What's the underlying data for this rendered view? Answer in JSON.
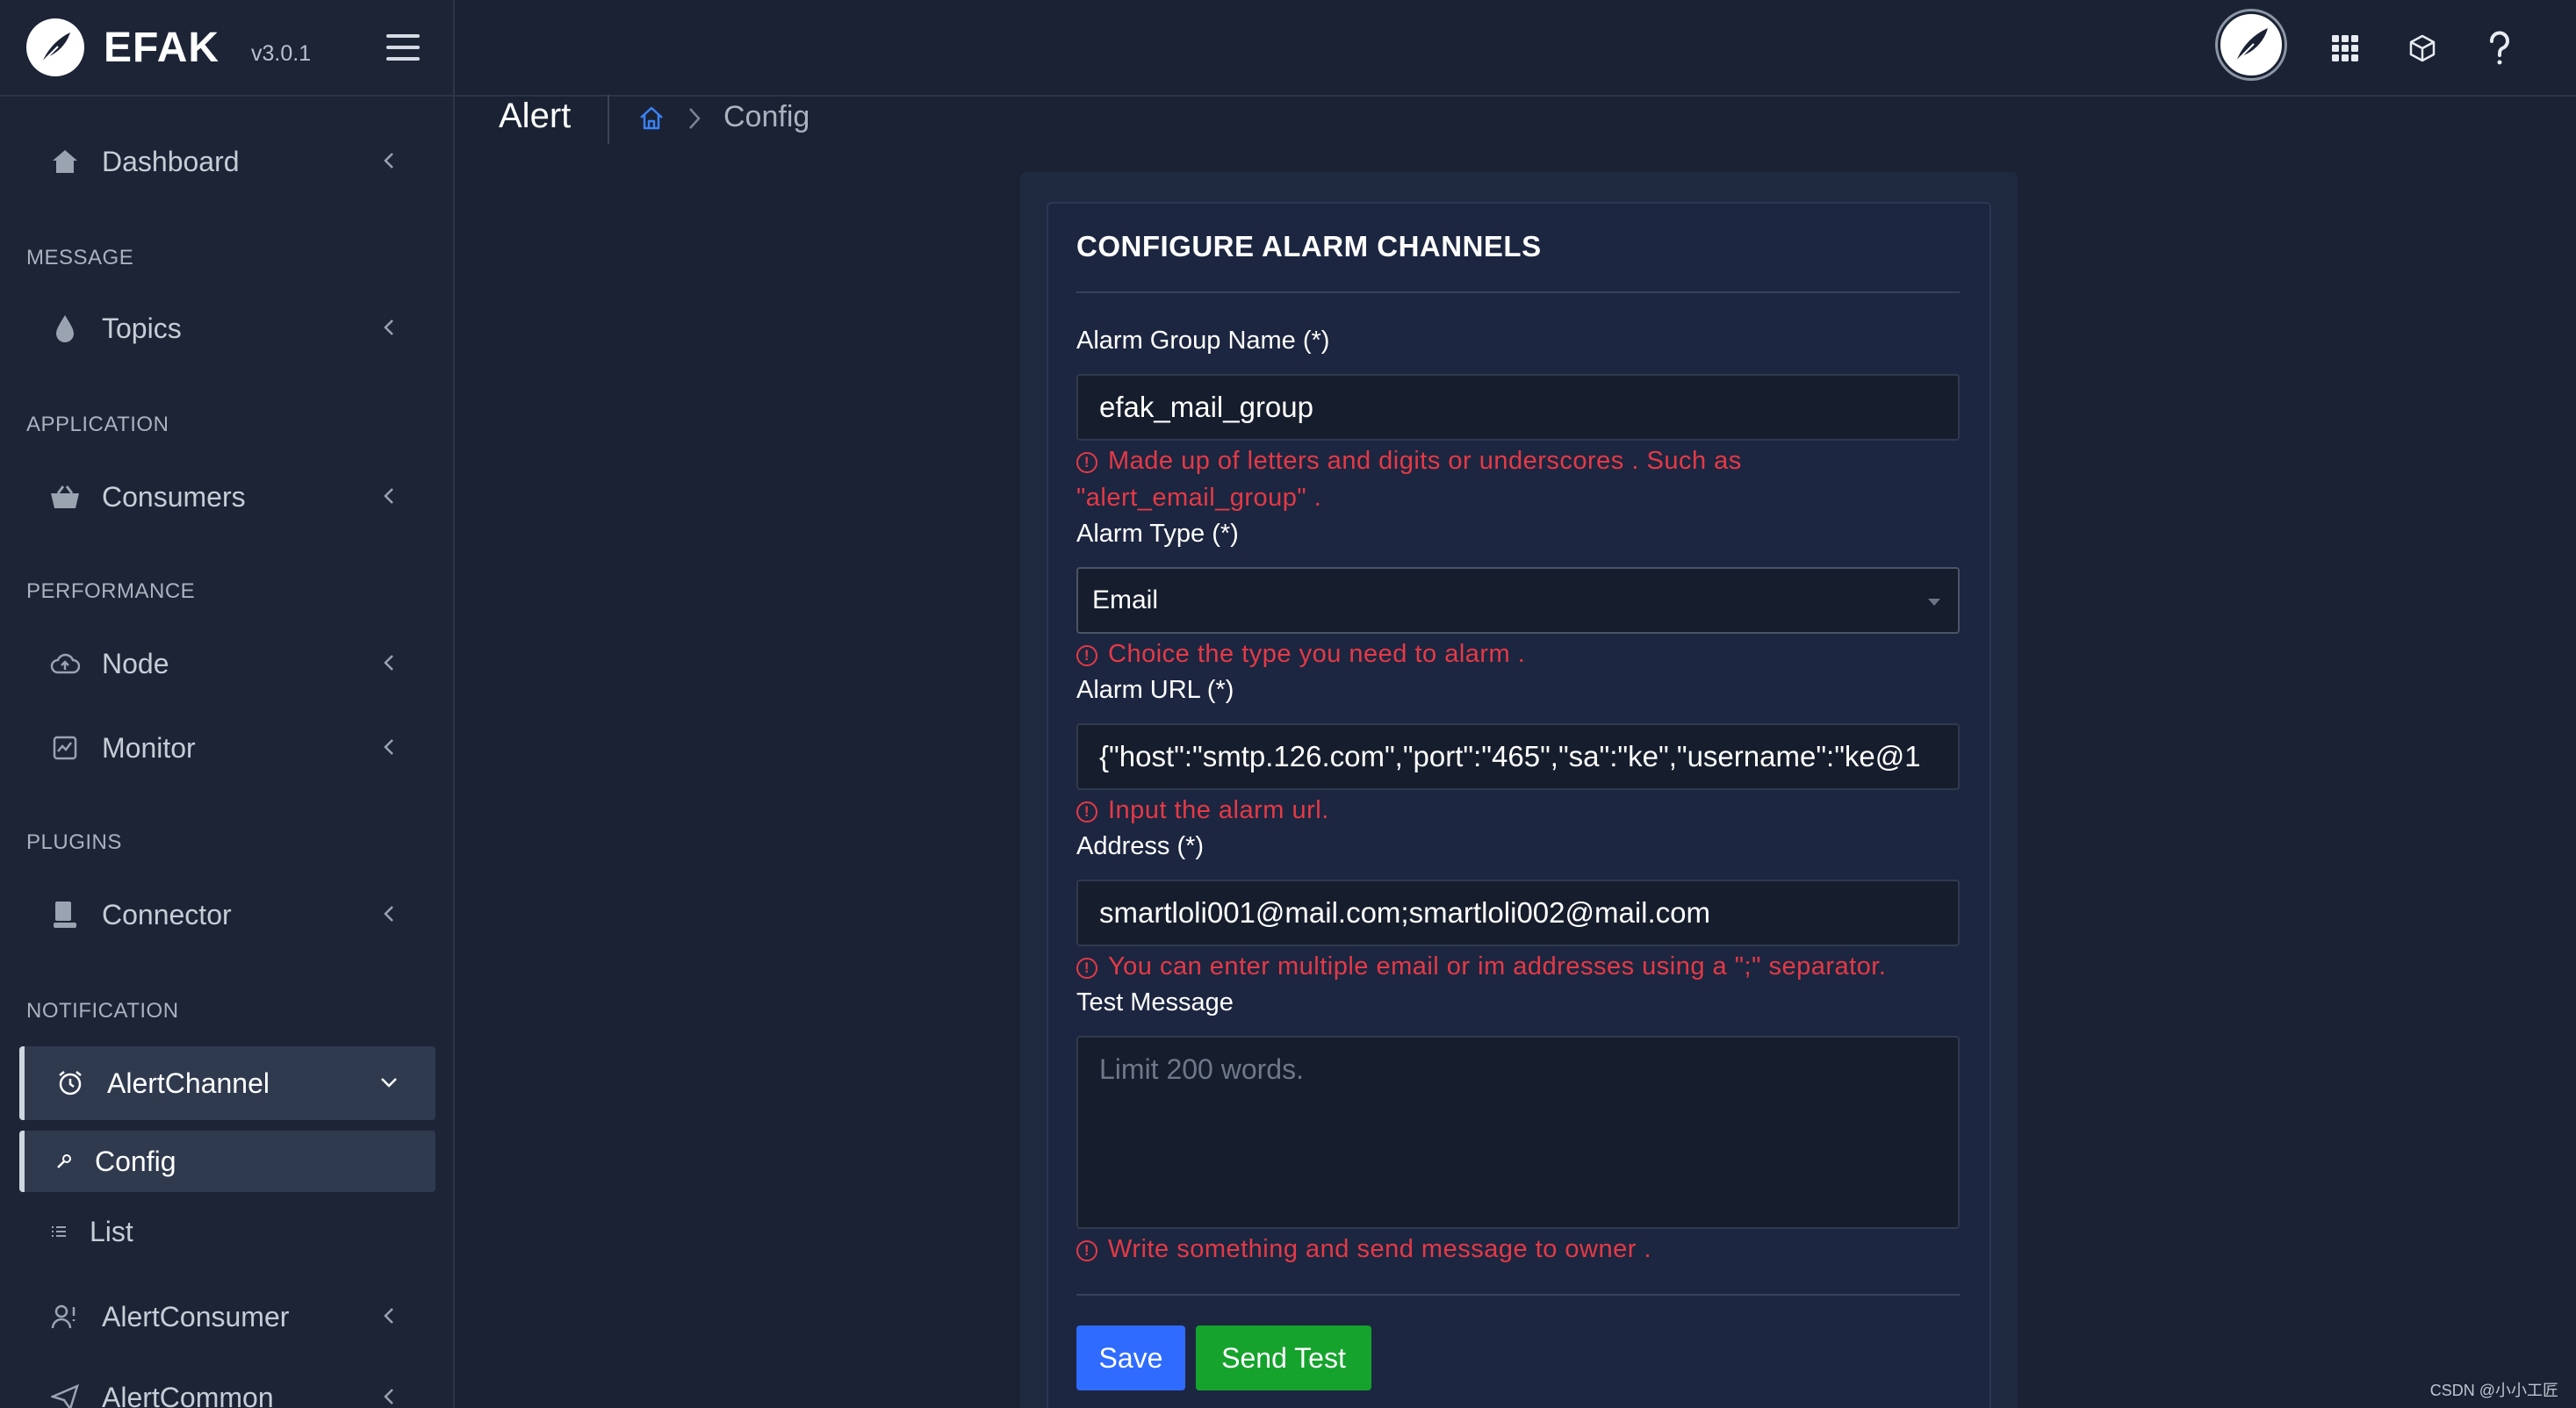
{
  "brand": {
    "name": "EFAK",
    "version": "v3.0.1"
  },
  "sidebar": {
    "dashboard": "Dashboard",
    "sections": {
      "message": "MESSAGE",
      "application": "APPLICATION",
      "performance": "PERFORMANCE",
      "plugins": "PLUGINS",
      "notification": "NOTIFICATION"
    },
    "topics": "Topics",
    "consumers": "Consumers",
    "node": "Node",
    "monitor": "Monitor",
    "connector": "Connector",
    "alert_channel": "AlertChannel",
    "alert_channel_sub": {
      "config": "Config",
      "list": "List"
    },
    "alert_consumer": "AlertConsumer",
    "alert_common": "AlertCommon"
  },
  "breadcrumb": {
    "page_title": "Alert",
    "current": "Config"
  },
  "form": {
    "title": "CONFIGURE ALARM CHANNELS",
    "group_name": {
      "label": "Alarm Group Name (*)",
      "value": "efak_mail_group",
      "hint_line1": "Made up of letters and digits or underscores . Such as",
      "hint_line2": "\"alert_email_group\" ."
    },
    "alarm_type": {
      "label": "Alarm Type (*)",
      "value": "Email",
      "hint": "Choice the type you need to alarm ."
    },
    "alarm_url": {
      "label": "Alarm URL (*)",
      "value": "{\"host\":\"smtp.126.com\",\"port\":\"465\",\"sa\":\"ke\",\"username\":\"ke@1",
      "hint": "Input the alarm url."
    },
    "address": {
      "label": "Address (*)",
      "value": "smartloli001@mail.com;smartloli002@mail.com",
      "hint": "You can enter multiple email or im addresses using a \";\" separator."
    },
    "test_message": {
      "label": "Test Message",
      "placeholder": "Limit 200 words.",
      "hint": "Write something and send message to owner ."
    },
    "save_label": "Save",
    "send_test_label": "Send Test"
  },
  "watermark": "CSDN @小小工匠",
  "colors": {
    "background": "#1a2234",
    "error": "#e63946",
    "save": "#2f6bff",
    "send_test": "#15a32d"
  },
  "icons": [
    "hamburger-icon",
    "feather-logo-icon",
    "apps-grid-icon",
    "cube-icon",
    "help-icon",
    "home-icon",
    "chevron-right-icon"
  ]
}
